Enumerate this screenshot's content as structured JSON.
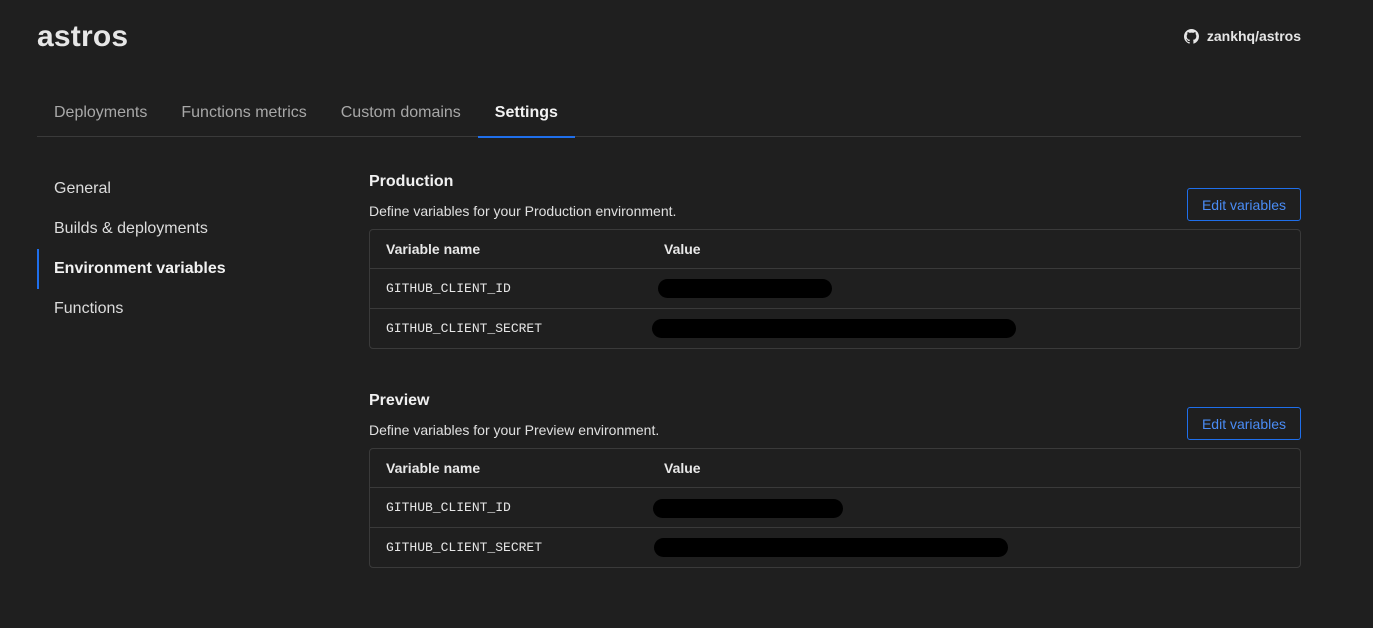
{
  "project": {
    "title": "astros"
  },
  "repo": {
    "label": "zankhq/astros",
    "icon": "github-icon"
  },
  "tabs": [
    {
      "label": "Deployments",
      "active": false
    },
    {
      "label": "Functions metrics",
      "active": false
    },
    {
      "label": "Custom domains",
      "active": false
    },
    {
      "label": "Settings",
      "active": true
    }
  ],
  "sidebar": {
    "items": [
      {
        "label": "General",
        "active": false
      },
      {
        "label": "Builds & deployments",
        "active": false
      },
      {
        "label": "Environment variables",
        "active": true
      },
      {
        "label": "Functions",
        "active": false
      }
    ]
  },
  "sections": {
    "production": {
      "title": "Production",
      "description": "Define variables for your Production environment.",
      "edit_label": "Edit variables",
      "headers": {
        "name": "Variable name",
        "value": "Value"
      },
      "rows": [
        {
          "name": "GITHUB_CLIENT_ID",
          "value_redacted": true
        },
        {
          "name": "GITHUB_CLIENT_SECRET",
          "value_redacted": true
        }
      ]
    },
    "preview": {
      "title": "Preview",
      "description": "Define variables for your Preview environment.",
      "edit_label": "Edit variables",
      "headers": {
        "name": "Variable name",
        "value": "Value"
      },
      "rows": [
        {
          "name": "GITHUB_CLIENT_ID",
          "value_redacted": true
        },
        {
          "name": "GITHUB_CLIENT_SECRET",
          "value_redacted": true
        }
      ]
    }
  },
  "colors": {
    "background": "#1f1f1f",
    "accent": "#1f6feb",
    "border": "#3a3a3a",
    "redaction": "#000000"
  }
}
